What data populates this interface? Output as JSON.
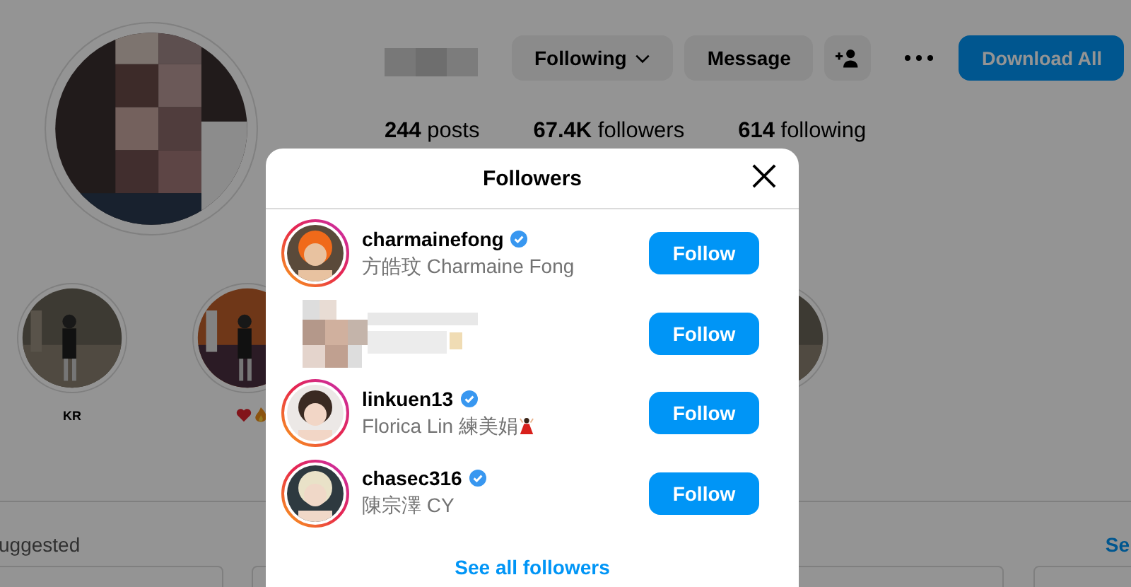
{
  "profile": {
    "buttons": [
      {
        "label": "Following",
        "dropdown": true
      },
      {
        "label": "Message",
        "dropdown": false
      }
    ],
    "primary_button": "Download All",
    "stats": [
      "**244** posts",
      "**67.4K** followers",
      "**614** following"
    ],
    "highlights": [
      {
        "kind": "text",
        "label": "KR"
      },
      {
        "kind": "emoji"
      },
      {
        "kind": "plain"
      }
    ],
    "suggested_heading": "uggested",
    "see_all_link": "Se"
  },
  "modal": {
    "title": "Followers",
    "followers": [
      {
        "kind": "account",
        "username": "charmainefong",
        "name": "方皓玟 Charmaine Fong",
        "verified": true,
        "emoji": false,
        "button": "Follow"
      },
      {
        "kind": "obscured",
        "button": "Follow"
      },
      {
        "kind": "account",
        "username": "linkuen13",
        "name": "Florica Lin 練美娟",
        "verified": true,
        "emoji": true,
        "button": "Follow"
      },
      {
        "kind": "account",
        "username": "chasec316",
        "name": "陳宗澤 CY",
        "verified": true,
        "emoji": false,
        "button": "Follow"
      }
    ],
    "footer_link": "See all followers"
  }
}
